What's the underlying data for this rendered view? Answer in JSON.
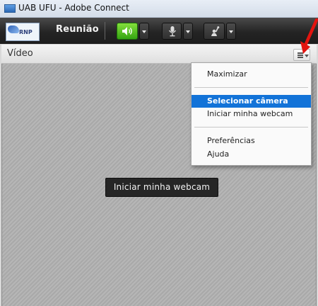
{
  "window": {
    "title": "UAB UFU - Adobe Connect"
  },
  "toolbar": {
    "logo_text": "RNP",
    "meeting_label": "Reunião",
    "colors": {
      "speaker_active": "#4bbf1e"
    }
  },
  "icons": {
    "speaker": "speaker-icon",
    "microphone": "microphone-icon",
    "status": "raise-hand-icon",
    "panel_menu": "menu-icon"
  },
  "panel": {
    "title": "Vídeo"
  },
  "video": {
    "start_button": "Iniciar minha webcam"
  },
  "menu": {
    "items": [
      {
        "label": "Maximizar"
      },
      {
        "label": "Selecionar câmera",
        "selected": true
      },
      {
        "label": "Iniciar minha webcam"
      },
      {
        "label": "Preferências"
      },
      {
        "label": "Ajuda"
      }
    ]
  },
  "annotation": {
    "color": "#e3140f"
  }
}
